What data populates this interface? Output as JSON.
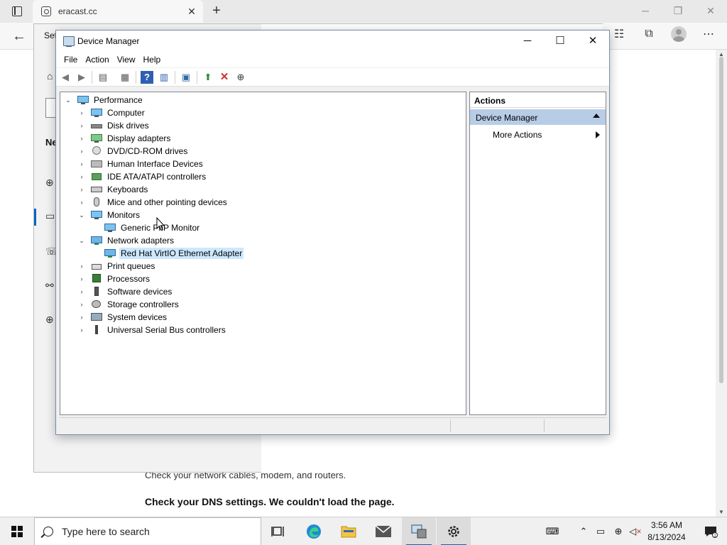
{
  "browser": {
    "tab_title": "eracast.cc",
    "page_text_1": "Check your network cables, modem, and routers.",
    "page_text_2": "Check your DNS settings. We couldn't load the page."
  },
  "settings_window": {
    "title_partial": "Set",
    "heading_partial": "Ne"
  },
  "device_manager": {
    "title": "Device Manager",
    "menu": [
      "File",
      "Action",
      "View",
      "Help"
    ],
    "tree": {
      "root": "Performance",
      "items": [
        {
          "label": "Computer",
          "expanded": false,
          "icon": "computer-icon"
        },
        {
          "label": "Disk drives",
          "expanded": false,
          "icon": "disk-drive-icon"
        },
        {
          "label": "Display adapters",
          "expanded": false,
          "icon": "display-adapter-icon"
        },
        {
          "label": "DVD/CD-ROM drives",
          "expanded": false,
          "icon": "dvd-drive-icon"
        },
        {
          "label": "Human Interface Devices",
          "expanded": false,
          "icon": "hid-icon"
        },
        {
          "label": "IDE ATA/ATAPI controllers",
          "expanded": false,
          "icon": "ide-controller-icon"
        },
        {
          "label": "Keyboards",
          "expanded": false,
          "icon": "keyboard-icon"
        },
        {
          "label": "Mice and other pointing devices",
          "expanded": false,
          "icon": "mouse-icon"
        },
        {
          "label": "Monitors",
          "expanded": true,
          "icon": "monitor-icon",
          "children": [
            "Generic PnP Monitor"
          ]
        },
        {
          "label": "Network adapters",
          "expanded": true,
          "icon": "network-adapter-icon",
          "children": [
            "Red Hat VirtIO Ethernet Adapter"
          ]
        },
        {
          "label": "Print queues",
          "expanded": false,
          "icon": "printer-icon"
        },
        {
          "label": "Processors",
          "expanded": false,
          "icon": "processor-icon"
        },
        {
          "label": "Software devices",
          "expanded": false,
          "icon": "software-device-icon"
        },
        {
          "label": "Storage controllers",
          "expanded": false,
          "icon": "storage-controller-icon"
        },
        {
          "label": "System devices",
          "expanded": false,
          "icon": "system-devices-icon"
        },
        {
          "label": "Universal Serial Bus controllers",
          "expanded": false,
          "icon": "usb-icon"
        }
      ],
      "selected": "Red Hat VirtIO Ethernet Adapter"
    },
    "actions": {
      "header": "Actions",
      "section": "Device Manager",
      "item": "More Actions"
    }
  },
  "taskbar": {
    "search_placeholder": "Type here to search",
    "time": "3:56 AM",
    "date": "8/13/2024"
  },
  "colors": {
    "accent": "#0067c0",
    "actions_section_bg": "#b7cde6",
    "selection_bg": "#cce8ff",
    "delete_red": "#d32f2f"
  }
}
